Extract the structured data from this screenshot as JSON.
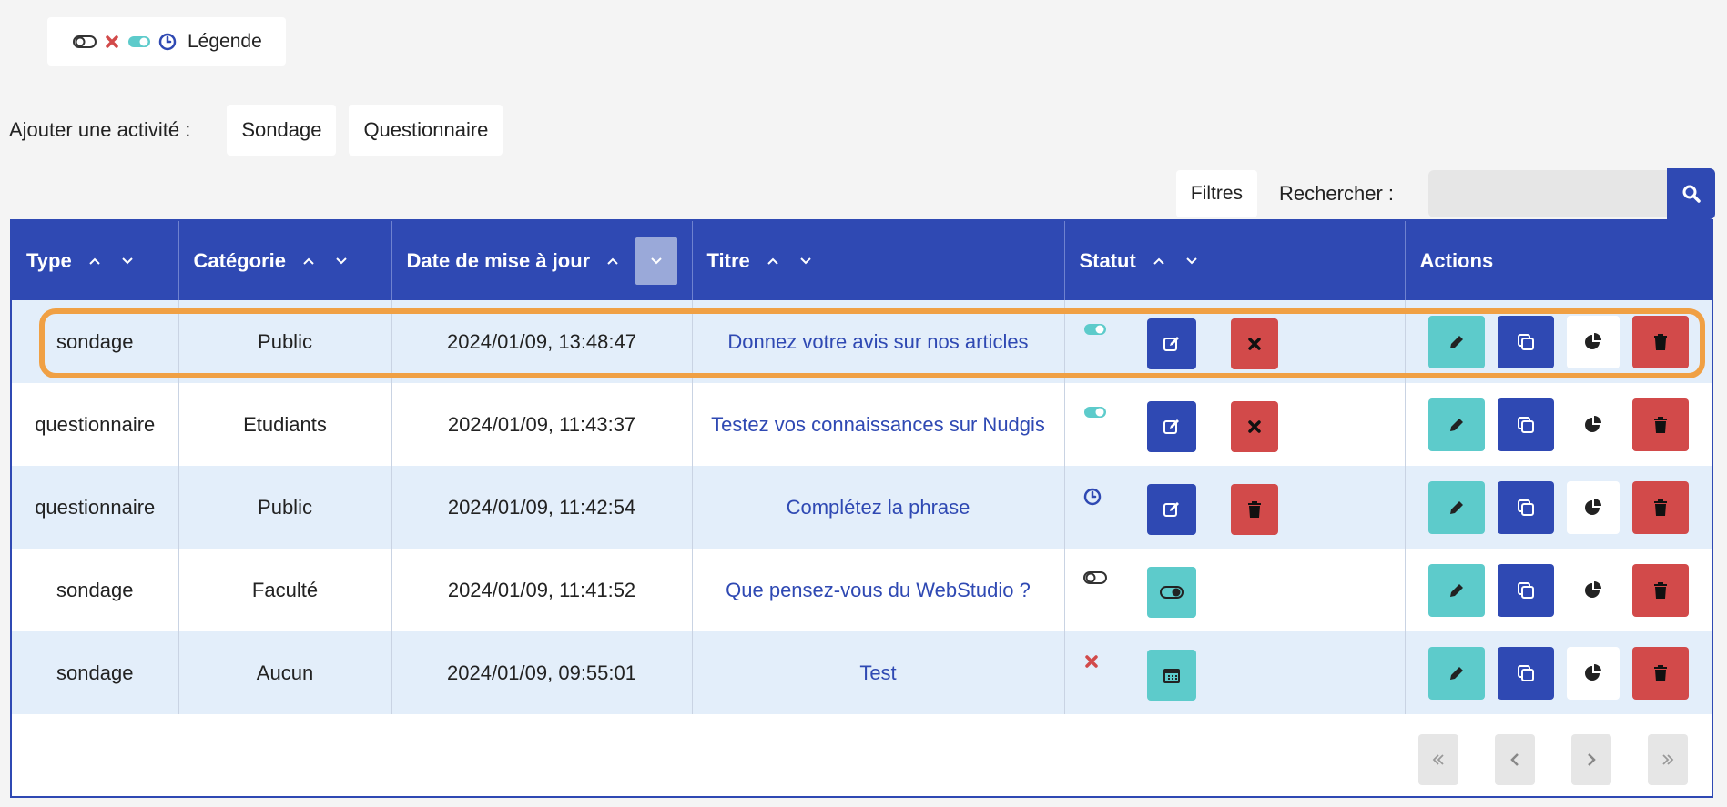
{
  "legend": {
    "label": "Légende"
  },
  "add_activity": {
    "label": "Ajouter une activité :",
    "buttons": [
      "Sondage",
      "Questionnaire"
    ]
  },
  "toolbar": {
    "filters_label": "Filtres",
    "search_label": "Rechercher :",
    "search_value": ""
  },
  "table": {
    "headers": [
      "Type",
      "Catégorie",
      "Date de mise à jour",
      "Titre",
      "Statut",
      "Actions"
    ],
    "rows": [
      {
        "type": "sondage",
        "category": "Public",
        "date": "2024/01/09, 13:48:47",
        "title": "Donnez votre avis sur nos articles",
        "status": "active"
      },
      {
        "type": "questionnaire",
        "category": "Etudiants",
        "date": "2024/01/09, 11:43:37",
        "title": "Testez vos connaissances sur Nudgis",
        "status": "active"
      },
      {
        "type": "questionnaire",
        "category": "Public",
        "date": "2024/01/09, 11:42:54",
        "title": "Complétez la phrase",
        "status": "scheduled"
      },
      {
        "type": "sondage",
        "category": "Faculté",
        "date": "2024/01/09, 11:41:52",
        "title": "Que pensez-vous du WebStudio ?",
        "status": "inactive"
      },
      {
        "type": "sondage",
        "category": "Aucun",
        "date": "2024/01/09, 09:55:01",
        "title": "Test",
        "status": "closed"
      }
    ]
  },
  "colors": {
    "primary": "#2f49b3",
    "danger": "#d24a4a",
    "teal": "#5dcbcb",
    "highlight": "#f0a044",
    "row_alt": "#e3eefa"
  },
  "icons": {
    "legend": [
      "toggle-off-icon",
      "x-icon",
      "toggle-on-icon",
      "clock-icon"
    ],
    "actions": [
      "pencil-icon",
      "copy-icon",
      "pie-chart-icon",
      "trash-icon"
    ],
    "pager": [
      "first-page-icon",
      "prev-page-icon",
      "next-page-icon",
      "last-page-icon"
    ]
  }
}
